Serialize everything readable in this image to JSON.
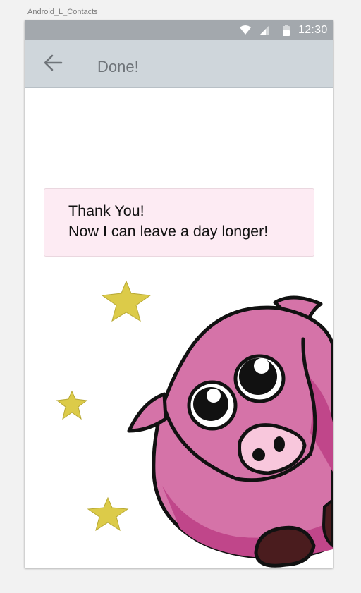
{
  "artboard": {
    "label": "Android_L_Contacts"
  },
  "status_bar": {
    "time": "12:30",
    "icons": [
      "wifi-icon",
      "signal-icon",
      "battery-icon"
    ]
  },
  "app_bar": {
    "back_icon": "arrow-left-icon",
    "title": "Done!"
  },
  "message": {
    "line1": "Thank You!",
    "line2": "Now I can leave a day longer!"
  },
  "illustration": {
    "subject": "pink-pig",
    "stars": 3
  },
  "colors": {
    "status_bar": "#a3a8ad",
    "app_bar": "#cfd6db",
    "card_bg": "#fdebf3",
    "pig_pink": "#d573a8",
    "pig_shadow": "#c0468a",
    "star": "#dccb49",
    "hoof": "#4a1c1e"
  }
}
